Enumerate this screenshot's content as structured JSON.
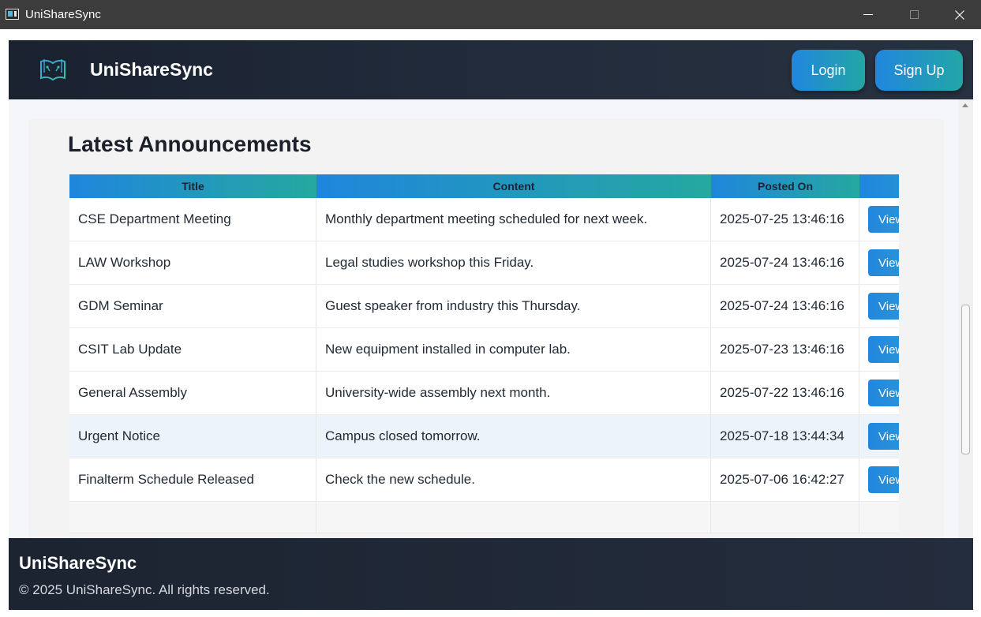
{
  "window": {
    "title": "UniShareSync",
    "minimize_icon": "minimize-icon",
    "maximize_icon": "maximize-icon",
    "close_glyph": "✕"
  },
  "header": {
    "brand": "UniShareSync",
    "logo_icon": "open-book-icon",
    "login_label": "Login",
    "signup_label": "Sign Up",
    "accent_start": "#2186de",
    "accent_end": "#22a6a6"
  },
  "announcements": {
    "title": "Latest Announcements",
    "columns": [
      "Title",
      "Content",
      "Posted On",
      ""
    ],
    "view_label": "View",
    "rows": [
      {
        "title": "CSE Department Meeting",
        "content": "Monthly department meeting scheduled for next week.",
        "posted": "2025-07-25 13:46:16"
      },
      {
        "title": "LAW Workshop",
        "content": "Legal studies workshop this Friday.",
        "posted": "2025-07-24 13:46:16"
      },
      {
        "title": "GDM Seminar",
        "content": "Guest speaker from industry this Thursday.",
        "posted": "2025-07-24 13:46:16"
      },
      {
        "title": "CSIT Lab Update",
        "content": "New equipment installed in computer lab.",
        "posted": "2025-07-23 13:46:16"
      },
      {
        "title": "General Assembly",
        "content": "University-wide assembly next month.",
        "posted": "2025-07-22 13:46:16"
      },
      {
        "title": "Urgent Notice",
        "content": "Campus closed tomorrow.",
        "posted": "2025-07-18 13:44:34"
      },
      {
        "title": "Finalterm Schedule Released",
        "content": "Check the new schedule.",
        "posted": "2025-07-06 16:42:27"
      }
    ]
  },
  "footer": {
    "brand": "UniShareSync",
    "copyright": "© 2025 UniShareSync. All rights reserved."
  }
}
